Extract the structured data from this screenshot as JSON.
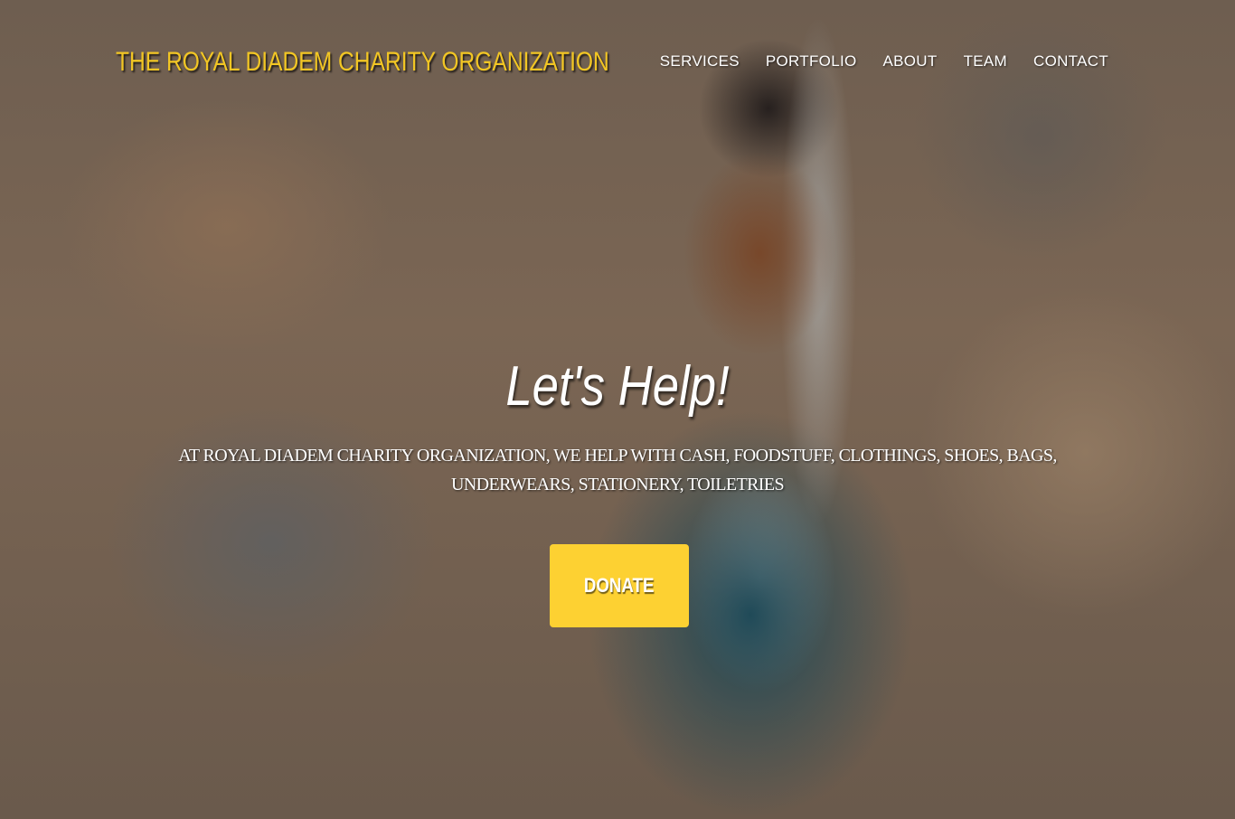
{
  "header": {
    "brand": "THE ROYAL DIADEM CHARITY ORGANIZATION",
    "nav": [
      "SERVICES",
      "PORTFOLIO",
      "ABOUT",
      "TEAM",
      "CONTACT"
    ]
  },
  "hero": {
    "headline": "Let's Help!",
    "tagline": "AT ROYAL DIADEM CHARITY ORGANIZATION, WE HELP WITH CASH, FOODSTUFF, CLOTHINGS, SHOES, BAGS, UNDERWEARS, STATIONERY, TOILETRIES",
    "donate_label": "DONATE"
  },
  "colors": {
    "accent": "#fdd132",
    "brand": "#f2c624"
  }
}
